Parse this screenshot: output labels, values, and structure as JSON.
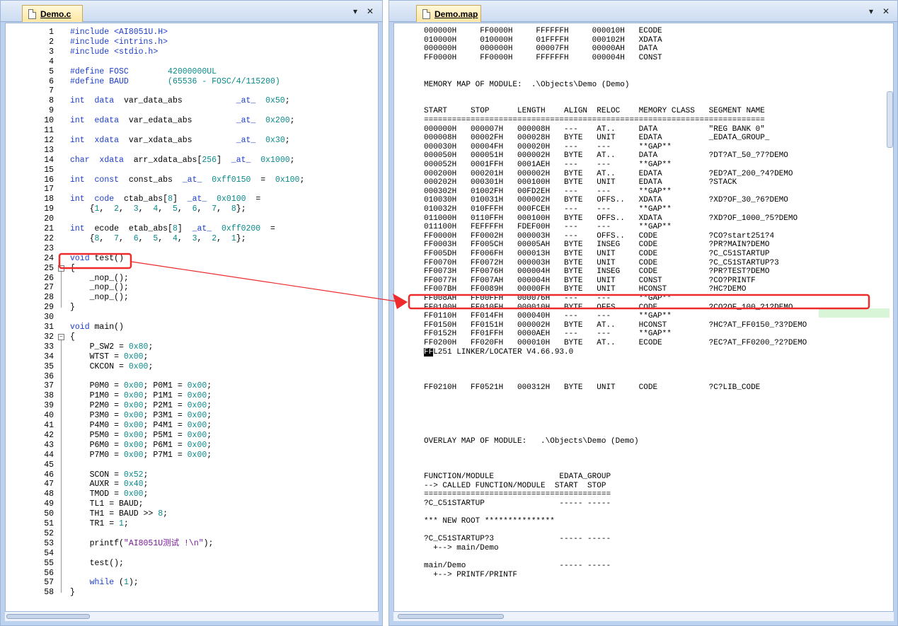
{
  "left_tab": {
    "label": "Demo.c"
  },
  "right_tab": {
    "label": "Demo.map"
  },
  "tab_controls": {
    "dropdown": "▾",
    "close": "✕"
  },
  "code_lines": [
    [
      [
        "pp",
        "#include <AI8051U.H>"
      ]
    ],
    [
      [
        "pp",
        "#include <intrins.h>"
      ]
    ],
    [
      [
        "pp",
        "#include <stdio.h>"
      ]
    ],
    [],
    [
      [
        "pp",
        "#define FOSC"
      ],
      [
        "t",
        "        "
      ],
      [
        "num",
        "42000000UL"
      ]
    ],
    [
      [
        "pp",
        "#define BAUD"
      ],
      [
        "t",
        "        "
      ],
      [
        "num",
        "(65536 - FOSC/4/115200)"
      ]
    ],
    [],
    [
      [
        "kw",
        "int"
      ],
      [
        "t",
        "  "
      ],
      [
        "kw",
        "data"
      ],
      [
        "t",
        "  var_data_abs           "
      ],
      [
        "kw",
        "_at_"
      ],
      [
        "t",
        "  "
      ],
      [
        "num",
        "0x50"
      ],
      [
        "t",
        ";"
      ]
    ],
    [],
    [
      [
        "kw",
        "int"
      ],
      [
        "t",
        "  "
      ],
      [
        "kw",
        "edata"
      ],
      [
        "t",
        "  var_edata_abs         "
      ],
      [
        "kw",
        "_at_"
      ],
      [
        "t",
        "  "
      ],
      [
        "num",
        "0x200"
      ],
      [
        "t",
        ";"
      ]
    ],
    [],
    [
      [
        "kw",
        "int"
      ],
      [
        "t",
        "  "
      ],
      [
        "kw",
        "xdata"
      ],
      [
        "t",
        "  var_xdata_abs         "
      ],
      [
        "kw",
        "_at_"
      ],
      [
        "t",
        "  "
      ],
      [
        "num",
        "0x30"
      ],
      [
        "t",
        ";"
      ]
    ],
    [],
    [
      [
        "kw",
        "char"
      ],
      [
        "t",
        "  "
      ],
      [
        "kw",
        "xdata"
      ],
      [
        "t",
        "  arr_xdata_abs["
      ],
      [
        "num",
        "256"
      ],
      [
        "t",
        "]  "
      ],
      [
        "kw",
        "_at_"
      ],
      [
        "t",
        "  "
      ],
      [
        "num",
        "0x1000"
      ],
      [
        "t",
        ";"
      ]
    ],
    [],
    [
      [
        "kw",
        "int"
      ],
      [
        "t",
        "  "
      ],
      [
        "kw",
        "const"
      ],
      [
        "t",
        "  const_abs  "
      ],
      [
        "kw",
        "_at_"
      ],
      [
        "t",
        "  "
      ],
      [
        "num",
        "0xff0150"
      ],
      [
        "t",
        "  =  "
      ],
      [
        "num",
        "0x100"
      ],
      [
        "t",
        ";"
      ]
    ],
    [],
    [
      [
        "kw",
        "int"
      ],
      [
        "t",
        "  "
      ],
      [
        "kw",
        "code"
      ],
      [
        "t",
        "  ctab_abs["
      ],
      [
        "num",
        "8"
      ],
      [
        "t",
        "]  "
      ],
      [
        "kw",
        "_at_"
      ],
      [
        "t",
        "  "
      ],
      [
        "num",
        "0x0100"
      ],
      [
        "t",
        "  ="
      ]
    ],
    [
      [
        "t",
        "    {"
      ],
      [
        "num",
        "1"
      ],
      [
        "t",
        ",  "
      ],
      [
        "num",
        "2"
      ],
      [
        "t",
        ",  "
      ],
      [
        "num",
        "3"
      ],
      [
        "t",
        ",  "
      ],
      [
        "num",
        "4"
      ],
      [
        "t",
        ",  "
      ],
      [
        "num",
        "5"
      ],
      [
        "t",
        ",  "
      ],
      [
        "num",
        "6"
      ],
      [
        "t",
        ",  "
      ],
      [
        "num",
        "7"
      ],
      [
        "t",
        ",  "
      ],
      [
        "num",
        "8"
      ],
      [
        "t",
        "};"
      ]
    ],
    [],
    [
      [
        "kw",
        "int"
      ],
      [
        "t",
        "  ecode  etab_abs["
      ],
      [
        "num",
        "8"
      ],
      [
        "t",
        "]  "
      ],
      [
        "kw",
        "_at_"
      ],
      [
        "t",
        "  "
      ],
      [
        "num",
        "0xff0200"
      ],
      [
        "t",
        "  ="
      ]
    ],
    [
      [
        "t",
        "    {"
      ],
      [
        "num",
        "8"
      ],
      [
        "t",
        ",  "
      ],
      [
        "num",
        "7"
      ],
      [
        "t",
        ",  "
      ],
      [
        "num",
        "6"
      ],
      [
        "t",
        ",  "
      ],
      [
        "num",
        "5"
      ],
      [
        "t",
        ",  "
      ],
      [
        "num",
        "4"
      ],
      [
        "t",
        ",  "
      ],
      [
        "num",
        "3"
      ],
      [
        "t",
        ",  "
      ],
      [
        "num",
        "2"
      ],
      [
        "t",
        ",  "
      ],
      [
        "num",
        "1"
      ],
      [
        "t",
        "};"
      ]
    ],
    [],
    [
      [
        "kw",
        "void"
      ],
      [
        "t",
        " test()"
      ]
    ],
    [
      [
        "t",
        "{"
      ]
    ],
    [
      [
        "t",
        "    _nop_();"
      ]
    ],
    [
      [
        "t",
        "    _nop_();"
      ]
    ],
    [
      [
        "t",
        "    _nop_();"
      ]
    ],
    [
      [
        "t",
        "}"
      ]
    ],
    [],
    [
      [
        "kw",
        "void"
      ],
      [
        "t",
        " main()"
      ]
    ],
    [
      [
        "t",
        "{"
      ]
    ],
    [
      [
        "t",
        "    P_SW2 = "
      ],
      [
        "num",
        "0x80"
      ],
      [
        "t",
        ";"
      ]
    ],
    [
      [
        "t",
        "    WTST = "
      ],
      [
        "num",
        "0x00"
      ],
      [
        "t",
        ";"
      ]
    ],
    [
      [
        "t",
        "    CKCON = "
      ],
      [
        "num",
        "0x00"
      ],
      [
        "t",
        ";"
      ]
    ],
    [],
    [
      [
        "t",
        "    P0M0 = "
      ],
      [
        "num",
        "0x00"
      ],
      [
        "t",
        "; P0M1 = "
      ],
      [
        "num",
        "0x00"
      ],
      [
        "t",
        ";"
      ]
    ],
    [
      [
        "t",
        "    P1M0 = "
      ],
      [
        "num",
        "0x00"
      ],
      [
        "t",
        "; P1M1 = "
      ],
      [
        "num",
        "0x00"
      ],
      [
        "t",
        ";"
      ]
    ],
    [
      [
        "t",
        "    P2M0 = "
      ],
      [
        "num",
        "0x00"
      ],
      [
        "t",
        "; P2M1 = "
      ],
      [
        "num",
        "0x00"
      ],
      [
        "t",
        ";"
      ]
    ],
    [
      [
        "t",
        "    P3M0 = "
      ],
      [
        "num",
        "0x00"
      ],
      [
        "t",
        "; P3M1 = "
      ],
      [
        "num",
        "0x00"
      ],
      [
        "t",
        ";"
      ]
    ],
    [
      [
        "t",
        "    P4M0 = "
      ],
      [
        "num",
        "0x00"
      ],
      [
        "t",
        "; P4M1 = "
      ],
      [
        "num",
        "0x00"
      ],
      [
        "t",
        ";"
      ]
    ],
    [
      [
        "t",
        "    P5M0 = "
      ],
      [
        "num",
        "0x00"
      ],
      [
        "t",
        "; P5M1 = "
      ],
      [
        "num",
        "0x00"
      ],
      [
        "t",
        ";"
      ]
    ],
    [
      [
        "t",
        "    P6M0 = "
      ],
      [
        "num",
        "0x00"
      ],
      [
        "t",
        "; P6M1 = "
      ],
      [
        "num",
        "0x00"
      ],
      [
        "t",
        ";"
      ]
    ],
    [
      [
        "t",
        "    P7M0 = "
      ],
      [
        "num",
        "0x00"
      ],
      [
        "t",
        "; P7M1 = "
      ],
      [
        "num",
        "0x00"
      ],
      [
        "t",
        ";"
      ]
    ],
    [],
    [
      [
        "t",
        "    SCON = "
      ],
      [
        "num",
        "0x52"
      ],
      [
        "t",
        ";"
      ]
    ],
    [
      [
        "t",
        "    AUXR = "
      ],
      [
        "num",
        "0x40"
      ],
      [
        "t",
        ";"
      ]
    ],
    [
      [
        "t",
        "    TMOD = "
      ],
      [
        "num",
        "0x00"
      ],
      [
        "t",
        ";"
      ]
    ],
    [
      [
        "t",
        "    TL1 = BAUD;"
      ]
    ],
    [
      [
        "t",
        "    TH1 = BAUD >> "
      ],
      [
        "num",
        "8"
      ],
      [
        "t",
        ";"
      ]
    ],
    [
      [
        "t",
        "    TR1 = "
      ],
      [
        "num",
        "1"
      ],
      [
        "t",
        ";"
      ]
    ],
    [],
    [
      [
        "t",
        "    printf("
      ],
      [
        "str",
        "\"AI8051U测试 !\\n\""
      ],
      [
        "t",
        ");"
      ]
    ],
    [],
    [
      [
        "t",
        "    test();"
      ]
    ],
    [],
    [
      [
        "t",
        "    "
      ],
      [
        "kw",
        "while"
      ],
      [
        "t",
        " ("
      ],
      [
        "num",
        "1"
      ],
      [
        "t",
        ");"
      ]
    ],
    [
      [
        "t",
        "}"
      ]
    ]
  ],
  "map_lines": [
    "000000H     FF0000H     FFFFFFH     000010H   ECODE",
    "010000H     010000H     01FFFFH     000102H   XDATA",
    "000000H     000000H     00007FH     00000AH   DATA",
    "FF0000H     FF0000H     FFFFFFH     000004H   CONST",
    "",
    "",
    "MEMORY MAP OF MODULE:  .\\Objects\\Demo (Demo)",
    "",
    "",
    "START     STOP      LENGTH    ALIGN  RELOC    MEMORY CLASS   SEGMENT NAME",
    "=========================================================================",
    "000000H   000007H   000008H   ---    AT..     DATA           \"REG BANK 0\"",
    "000008H   00002FH   000028H   BYTE   UNIT     EDATA          _EDATA_GROUP_",
    "000030H   00004FH   000020H   ---    ---      **GAP**",
    "000050H   000051H   000002H   BYTE   AT..     DATA           ?DT?AT_50_?7?DEMO",
    "000052H   0001FFH   0001AEH   ---    ---      **GAP**",
    "000200H   000201H   000002H   BYTE   AT..     EDATA          ?ED?AT_200_?4?DEMO",
    "000202H   000301H   000100H   BYTE   UNIT     EDATA          ?STACK",
    "000302H   01002FH   00FD2EH   ---    ---      **GAP**",
    "010030H   010031H   000002H   BYTE   OFFS..   XDATA          ?XD?OF_30_?6?DEMO",
    "010032H   010FFFH   000FCEH   ---    ---      **GAP**",
    "011000H   0110FFH   000100H   BYTE   OFFS..   XDATA          ?XD?OF_1000_?5?DEMO",
    "011100H   FEFFFFH   FDEF00H   ---    ---      **GAP**",
    "FF0000H   FF0002H   000003H   ---    OFFS..   CODE           ?CO?start251?4",
    "FF0003H   FF005CH   00005AH   BYTE   INSEG    CODE           ?PR?MAIN?DEMO",
    "FF005DH   FF006FH   000013H   BYTE   UNIT     CODE           ?C_C51STARTUP",
    "FF0070H   FF0072H   000003H   BYTE   UNIT     CODE           ?C_C51STARTUP?3",
    "FF0073H   FF0076H   000004H   BYTE   INSEG    CODE           ?PR?TEST?DEMO",
    "FF0077H   FF007AH   000004H   BYTE   UNIT     CONST          ?CO?PRINTF",
    "FF007BH   FF0089H   00000FH   BYTE   UNIT     HCONST         ?HC?DEMO",
    "FF008AH   FF00FFH   000076H   ---    ---      **GAP**",
    "FF0100H   FF010FH   000010H   BYTE   OFFS..   CODE           ?CO?OF_100_?1?DEMO",
    "FF0110H   FF014FH   000040H   ---    ---      **GAP**",
    "FF0150H   FF0151H   000002H   BYTE   AT..     HCONST         ?HC?AT_FF0150_?3?DEMO",
    "FF0152H   FF01FFH   0000AEH   ---    ---      **GAP**",
    "FF0200H   FF020FH   000010H   BYTE   AT..     ECODE          ?EC?AT_FF0200_?2?DEMO",
    "L251 LINKER/LOCATER V4.66.93.0",
    "",
    "",
    "",
    "FF0210H   FF0521H   000312H   BYTE   UNIT     CODE           ?C?LIB_CODE",
    "",
    "",
    "",
    "",
    "",
    "OVERLAY MAP OF MODULE:   .\\Objects\\Demo (Demo)",
    "",
    "",
    "",
    "FUNCTION/MODULE              EDATA_GROUP",
    "--> CALLED FUNCTION/MODULE  START  STOP",
    "========================================",
    "?C_C51STARTUP                ----- -----",
    "",
    "*** NEW ROOT ***************",
    "",
    "?C_C51STARTUP?3              ----- -----",
    "  +--> main/Demo",
    "",
    "main/Demo                    ----- -----",
    "  +--> PRINTF/PRINTF"
  ],
  "cursor_glyph": "FF",
  "annotation": {
    "color": "#ee2a2a"
  }
}
